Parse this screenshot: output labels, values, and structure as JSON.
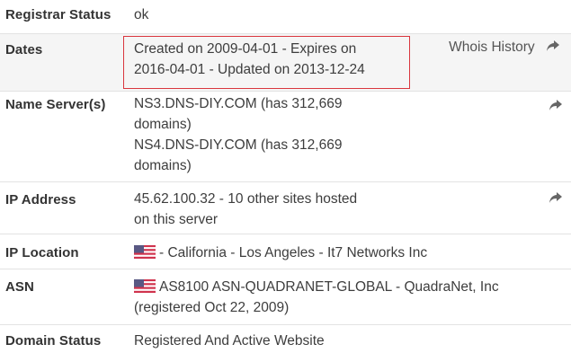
{
  "rows": {
    "registrar_status": {
      "label": "Registrar Status",
      "value": "ok"
    },
    "dates": {
      "label": "Dates",
      "line1": "Created on 2009-04-01 - Expires on",
      "line2": "2016-04-01 - Updated on 2013-12-24",
      "link": "Whois History"
    },
    "name_servers": {
      "label": "Name Server(s)",
      "lines": [
        "NS3.DNS-DIY.COM (has 312,669",
        "domains)",
        "NS4.DNS-DIY.COM (has 312,669",
        "domains)"
      ]
    },
    "ip_address": {
      "label": "IP Address",
      "line1": "45.62.100.32 - 10 other sites hosted",
      "line2": "on this server"
    },
    "ip_location": {
      "label": "IP Location",
      "value": "- California - Los Angeles - It7 Networks Inc",
      "flag_icon": "us-flag-icon"
    },
    "asn": {
      "label": "ASN",
      "line1": "AS8100 ASN-QUADRANET-GLOBAL - QuadraNet, Inc",
      "line2": "(registered Oct 22, 2009)",
      "flag_icon": "us-flag-icon"
    },
    "domain_status": {
      "label": "Domain Status",
      "value": "Registered And Active Website"
    }
  },
  "colors": {
    "highlight_border": "#d9363e",
    "shaded_row": "#f5f5f5",
    "divider": "#e3e3e3"
  },
  "icons": [
    "share-arrow-icon",
    "us-flag-icon"
  ]
}
